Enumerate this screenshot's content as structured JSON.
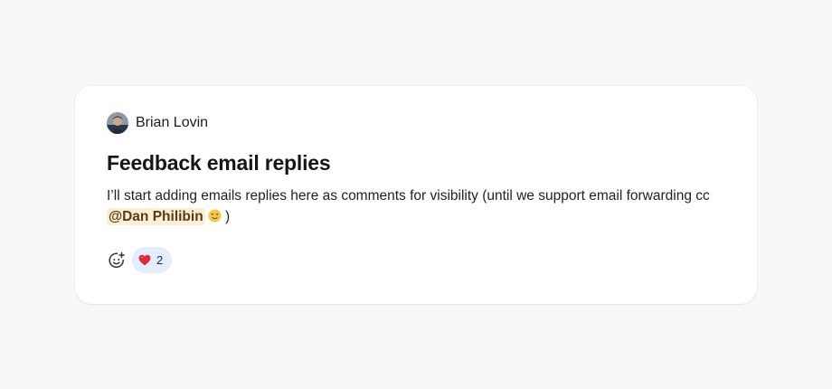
{
  "post": {
    "author": {
      "name": "Brian Lovin",
      "avatar_icon": "person-avatar"
    },
    "title": "Feedback email replies",
    "body_before": "I’ll start adding emails replies here as comments for visibility (until we support email forwarding cc ",
    "mention": "@Dan Philibin",
    "emoji_icon": "wink-face-emoji",
    "body_after": " )"
  },
  "reactions": {
    "add_icon": "add-emoji-icon",
    "items": [
      {
        "emoji_icon": "red-heart-emoji",
        "count": "2"
      }
    ]
  },
  "colors": {
    "page_bg": "#f8f8f8",
    "card_bg": "#ffffff",
    "mention_bg": "#fdefd6",
    "reaction_bg": "#e3edfb",
    "heart": "#e0263a"
  }
}
